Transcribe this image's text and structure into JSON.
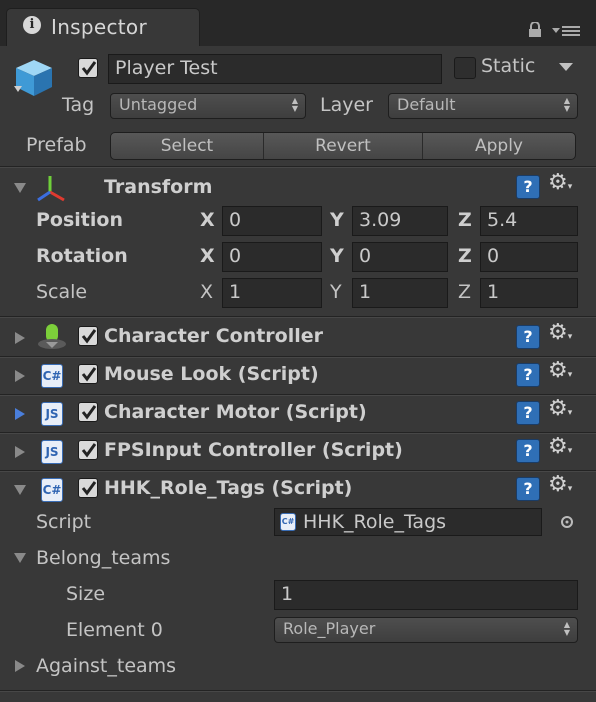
{
  "tab": {
    "title": "Inspector",
    "icon": "info-icon"
  },
  "object": {
    "name": "Player Test",
    "active": true,
    "static_label": "Static",
    "static_checked": false,
    "tag_label": "Tag",
    "tag_value": "Untagged",
    "layer_label": "Layer",
    "layer_value": "Default",
    "prefab_label": "Prefab",
    "prefab_buttons": {
      "select": "Select",
      "revert": "Revert",
      "apply": "Apply"
    }
  },
  "transform": {
    "title": "Transform",
    "position": {
      "label": "Position",
      "x": "0",
      "y": "3.09",
      "z": "5.4"
    },
    "rotation": {
      "label": "Rotation",
      "x": "0",
      "y": "0",
      "z": "0"
    },
    "scale": {
      "label": "Scale",
      "x": "1",
      "y": "1",
      "z": "1"
    },
    "axis": {
      "x": "X",
      "y": "Y",
      "z": "Z"
    }
  },
  "components": [
    {
      "name": "Character Controller",
      "icon": "character-controller-icon",
      "enabled": true
    },
    {
      "name": "Mouse Look (Script)",
      "icon": "csharp-script-icon",
      "enabled": true
    },
    {
      "name": "Character Motor (Script)",
      "icon": "js-script-icon",
      "enabled": true
    },
    {
      "name": "FPSInput Controller (Script)",
      "icon": "js-script-icon",
      "enabled": true
    },
    {
      "name": "HHK_Role_Tags (Script)",
      "icon": "csharp-script-icon",
      "enabled": true
    }
  ],
  "icons": {
    "cs": "C#",
    "js": "JS",
    "help": "?",
    "gear": "⚙",
    "gear_arrow": "▾"
  },
  "role_tags": {
    "script_label": "Script",
    "script_value": "HHK_Role_Tags",
    "belong_teams_label": "Belong_teams",
    "size_label": "Size",
    "size_value": "1",
    "element0_label": "Element 0",
    "element0_value": "Role_Player",
    "against_teams_label": "Against_teams"
  },
  "colors": {
    "background": "#383838",
    "field": "#2b2b2b",
    "help_blue": "#2f6fb6",
    "fold_active": "#4a7fdc"
  }
}
